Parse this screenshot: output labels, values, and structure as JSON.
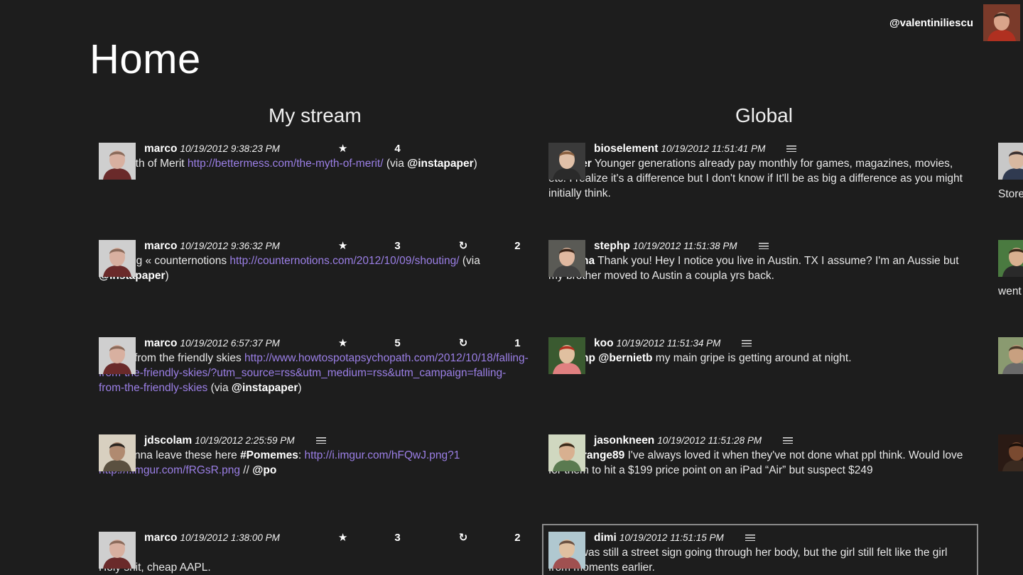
{
  "header": {
    "title": "Home",
    "username": "@valentiniliescu"
  },
  "columns": {
    "my_stream": {
      "title": "My stream",
      "posts": [
        {
          "user": "marco",
          "time": "10/19/2012 9:38:23 PM",
          "stars": "4",
          "reposts": "",
          "has_list_icon": false,
          "parts": [
            {
              "t": "text",
              "v": "The Myth of Merit "
            },
            {
              "t": "link",
              "v": "http://bettermess.com/the-myth-of-merit/"
            },
            {
              "t": "text",
              "v": " (via "
            },
            {
              "t": "mention",
              "v": "@instapaper"
            },
            {
              "t": "text",
              "v": ")"
            }
          ]
        },
        {
          "user": "marco",
          "time": "10/19/2012 9:36:32 PM",
          "stars": "3",
          "reposts": "2",
          "has_list_icon": false,
          "parts": [
            {
              "t": "text",
              "v": "Shouting « counternotions "
            },
            {
              "t": "link",
              "v": "http://counternotions.com/2012/10/09/shouting/"
            },
            {
              "t": "text",
              "v": " (via "
            },
            {
              "t": "mention",
              "v": "@instapaper"
            },
            {
              "t": "text",
              "v": ")"
            }
          ]
        },
        {
          "user": "marco",
          "time": "10/19/2012 6:57:37 PM",
          "stars": "5",
          "reposts": "1",
          "has_list_icon": false,
          "parts": [
            {
              "t": "text",
              "v": "Falling from the friendly skies "
            },
            {
              "t": "link",
              "v": "http://www.howtospotapsychopath.com/2012/10/18/falling-from-the-friendly-skies/?utm_source=rss&utm_medium=rss&utm_campaign=falling-from-the-friendly-skies"
            },
            {
              "t": "text",
              "v": " (via "
            },
            {
              "t": "mention",
              "v": "@instapaper"
            },
            {
              "t": "text",
              "v": ")"
            }
          ]
        },
        {
          "user": "jdscolam",
          "time": "10/19/2012 2:25:59 PM",
          "stars": "",
          "reposts": "",
          "has_list_icon": true,
          "parts": [
            {
              "t": "text",
              "v": "Just gonna leave these here "
            },
            {
              "t": "tag",
              "v": "#Pomemes"
            },
            {
              "t": "text",
              "v": ": "
            },
            {
              "t": "link",
              "v": "http://i.imgur.com/hFQwJ.png?1"
            },
            {
              "t": "text",
              "v": " "
            },
            {
              "t": "link",
              "v": "http://i.imgur.com/fRGsR.png"
            },
            {
              "t": "text",
              "v": " // "
            },
            {
              "t": "mention",
              "v": "@po"
            }
          ]
        },
        {
          "user": "marco",
          "time": "10/19/2012 1:38:00 PM",
          "stars": "3",
          "reposts": "2",
          "has_list_icon": true,
          "parts": [
            {
              "t": "text",
              "v": "Holy shit, cheap AAPL."
            }
          ]
        }
      ]
    },
    "global": {
      "title": "Global",
      "posts": [
        {
          "user": "bioselement",
          "time": "10/19/2012 11:51:41 PM",
          "stars": "",
          "reposts": "",
          "has_list_icon": true,
          "parts": [
            {
              "t": "mention",
              "v": "@lvcifer"
            },
            {
              "t": "text",
              "v": " Younger generations already pay monthly for games, magazines, movies, etc. I realize it's a difference but I don't know if It'll be as big a difference as you might initially think."
            }
          ]
        },
        {
          "user": "stephp",
          "time": "10/19/2012 11:51:38 PM",
          "stars": "",
          "reposts": "",
          "has_list_icon": true,
          "parts": [
            {
              "t": "mention",
              "v": "@joanna"
            },
            {
              "t": "text",
              "v": " Thank you! Hey I notice you live in Austin. TX I assume? I'm an Aussie but my brother moved to Austin a coupla yrs back."
            }
          ]
        },
        {
          "user": "koo",
          "time": "10/19/2012 11:51:34 PM",
          "stars": "",
          "reposts": "",
          "has_list_icon": true,
          "parts": [
            {
              "t": "mention",
              "v": "@stephp"
            },
            {
              "t": "text",
              "v": " "
            },
            {
              "t": "mention",
              "v": "@bernietb"
            },
            {
              "t": "text",
              "v": " my main gripe is getting around at night."
            }
          ]
        },
        {
          "user": "jasonkneen",
          "time": "10/19/2012 11:51:28 PM",
          "stars": "",
          "reposts": "",
          "has_list_icon": true,
          "parts": [
            {
              "t": "mention",
              "v": "@jefforange89"
            },
            {
              "t": "text",
              "v": " I've always loved it when they've not done what ppl think. Would love for them to hit a $199 price point on an iPad “Air” but suspect $249"
            }
          ]
        },
        {
          "user": "dimi",
          "time": "10/19/2012 11:51:15 PM",
          "stars": "",
          "reposts": "",
          "has_list_icon": true,
          "parts": [
            {
              "t": "text",
              "v": "There was still a street sign going through her body, but the girl still felt like the girl from moments earlier."
            }
          ]
        }
      ]
    }
  },
  "peek": {
    "texts": [
      "Store",
      "went"
    ]
  },
  "avatars": {
    "me": {
      "bg": "#7a3a2a",
      "face": "#d9a48a",
      "hair": "#3a2a20",
      "shirt": "#b03020"
    },
    "marco": {
      "bg": "#cfcfcf",
      "face": "#d8b0a0",
      "hair": "#8a6a5a",
      "shirt": "#6a2a2a"
    },
    "jdscolam": {
      "bg": "#d8d0c0",
      "face": "#b08a70",
      "hair": "#2a2520",
      "shirt": "#5a5040"
    },
    "bioselement": {
      "bg": "#3a3a3a",
      "face": "#e0c0a8",
      "hair": "#8a6040",
      "shirt": "#2a2a2a"
    },
    "stephp": {
      "bg": "#5a5a55",
      "face": "#e0b8a0",
      "hair": "#3a2418",
      "shirt": "#404040"
    },
    "koo": {
      "bg": "#3a5a30",
      "face": "#e0c0a0",
      "hair": "#b03020",
      "shirt": "#e08080"
    },
    "jasonkneen": {
      "bg": "#d0d8c0",
      "face": "#d8b090",
      "hair": "#3a2a1a",
      "shirt": "#5a7a50"
    },
    "dimi": {
      "bg": "#b0c8d0",
      "face": "#e0c0a0",
      "hair": "#6a5040",
      "shirt": "#a05050"
    },
    "peek1": {
      "bg": "#c8c8c8",
      "face": "#d8b8a0",
      "hair": "#3a3030",
      "shirt": "#303a50"
    },
    "peek2": {
      "bg": "#4a7a40",
      "face": "#d8b090",
      "hair": "#3a2a1a",
      "shirt": "#2a2a2a"
    },
    "peek3": {
      "bg": "#8a9a70",
      "face": "#c8a080",
      "hair": "#4a3a2a",
      "shirt": "#6a6a6a"
    },
    "peek4": {
      "bg": "#2a1a14",
      "face": "#7a4a30",
      "hair": "#1a100a",
      "shirt": "#3a2a20"
    }
  }
}
